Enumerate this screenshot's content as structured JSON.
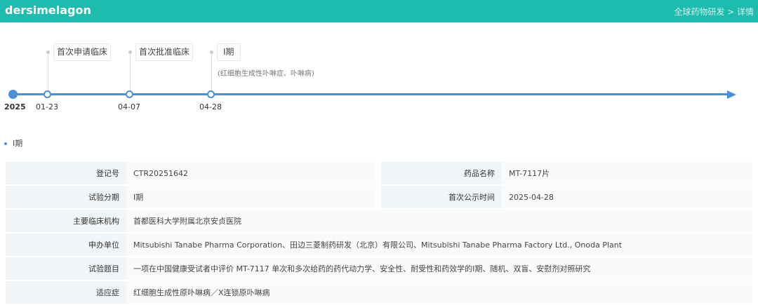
{
  "header": {
    "title": "dersimelagon",
    "breadcrumb": "全球药物研发 > 详情"
  },
  "timeline": {
    "year": "2025",
    "events": [
      {
        "label": "首次申请临床",
        "date": "01-23"
      },
      {
        "label": "首次批准临床",
        "date": "04-07"
      },
      {
        "label": "Ⅰ期",
        "date": "04-28",
        "sub": "(红细胞生成性卟啉症、卟啉病)"
      }
    ]
  },
  "section": {
    "title": "Ⅰ期"
  },
  "details": {
    "reg_no_label": "登记号",
    "reg_no": "CTR20251642",
    "drug_label": "药品名称",
    "drug": "MT-7117片",
    "phase_label": "试验分期",
    "phase": "Ⅰ期",
    "pub_label": "首次公示时间",
    "pub": "2025-04-28",
    "inst_label": "主要临床机构",
    "inst": "首都医科大学附属北京安贞医院",
    "sponsor_label": "申办单位",
    "sponsor": "Mitsubishi Tanabe Pharma Corporation、田边三菱制药研发（北京）有限公司、Mitsubishi Tanabe Pharma Factory Ltd., Onoda Plant",
    "title_label": "试验题目",
    "title": "一项在中国健康受试者中评价 MT-7117 单次和多次给药的药代动力学、安全性、耐受性和药效学的Ⅰ期、随机、双盲、安慰剂对照研究",
    "ind_label": "适应症",
    "ind": "红细胞生成性原卟啉病／X连锁原卟啉病"
  }
}
